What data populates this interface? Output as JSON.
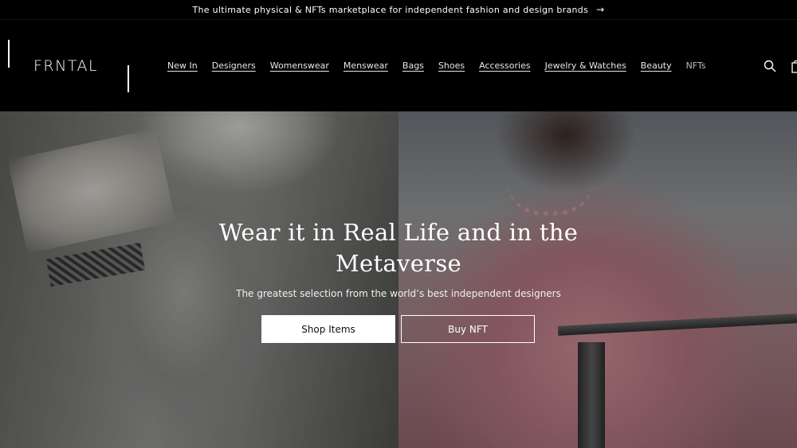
{
  "announcement": {
    "text": "The ultimate physical & NFTs marketplace for independent fashion and design brands",
    "arrow": "→"
  },
  "header": {
    "logo": "FRNTAL",
    "nav": [
      {
        "label": "New In"
      },
      {
        "label": "Designers"
      },
      {
        "label": "Womenswear"
      },
      {
        "label": "Menswear"
      },
      {
        "label": "Bags"
      },
      {
        "label": "Shoes"
      },
      {
        "label": "Accessories"
      },
      {
        "label": "Jewelry & Watches"
      },
      {
        "label": "Beauty"
      },
      {
        "label": "NFTs"
      }
    ],
    "icons": [
      "search-icon",
      "cart-icon"
    ]
  },
  "hero": {
    "title": "Wear it in Real Life and in the Metaverse",
    "subtitle": "The greatest selection from the world’s best independent designers",
    "primary_button": "Shop Items",
    "secondary_button": "Buy NFT"
  },
  "colors": {
    "background": "#000000",
    "text": "#ffffff",
    "button_primary_bg": "#ffffff",
    "button_primary_text": "#111111"
  }
}
